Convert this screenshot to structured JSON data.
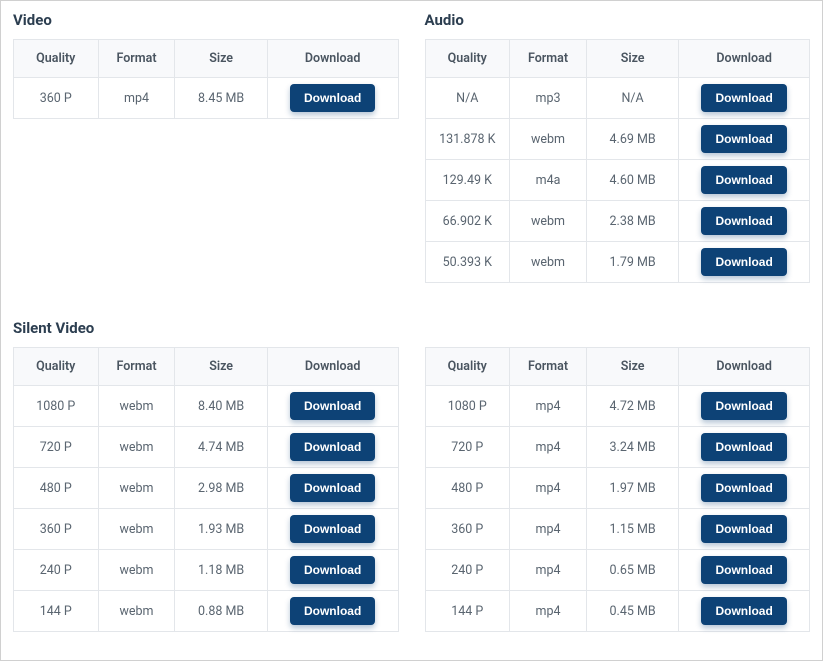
{
  "headings": {
    "video": "Video",
    "audio": "Audio",
    "silent_video": "Silent Video"
  },
  "columns": {
    "quality": "Quality",
    "format": "Format",
    "size": "Size",
    "download": "Download"
  },
  "download_button_label": "Download",
  "sections": {
    "video": {
      "rows": [
        {
          "quality": "360 P",
          "format": "mp4",
          "size": "8.45 MB"
        }
      ]
    },
    "audio": {
      "rows": [
        {
          "quality": "N/A",
          "format": "mp3",
          "size": "N/A"
        },
        {
          "quality": "131.878 K",
          "format": "webm",
          "size": "4.69 MB"
        },
        {
          "quality": "129.49 K",
          "format": "m4a",
          "size": "4.60 MB"
        },
        {
          "quality": "66.902 K",
          "format": "webm",
          "size": "2.38 MB"
        },
        {
          "quality": "50.393 K",
          "format": "webm",
          "size": "1.79 MB"
        }
      ]
    },
    "silent_video_left": {
      "rows": [
        {
          "quality": "1080 P",
          "format": "webm",
          "size": "8.40 MB"
        },
        {
          "quality": "720 P",
          "format": "webm",
          "size": "4.74 MB"
        },
        {
          "quality": "480 P",
          "format": "webm",
          "size": "2.98 MB"
        },
        {
          "quality": "360 P",
          "format": "webm",
          "size": "1.93 MB"
        },
        {
          "quality": "240 P",
          "format": "webm",
          "size": "1.18 MB"
        },
        {
          "quality": "144 P",
          "format": "webm",
          "size": "0.88 MB"
        }
      ]
    },
    "silent_video_right": {
      "rows": [
        {
          "quality": "1080 P",
          "format": "mp4",
          "size": "4.72 MB"
        },
        {
          "quality": "720 P",
          "format": "mp4",
          "size": "3.24 MB"
        },
        {
          "quality": "480 P",
          "format": "mp4",
          "size": "1.97 MB"
        },
        {
          "quality": "360 P",
          "format": "mp4",
          "size": "1.15 MB"
        },
        {
          "quality": "240 P",
          "format": "mp4",
          "size": "0.65 MB"
        },
        {
          "quality": "144 P",
          "format": "mp4",
          "size": "0.45 MB"
        }
      ]
    }
  }
}
